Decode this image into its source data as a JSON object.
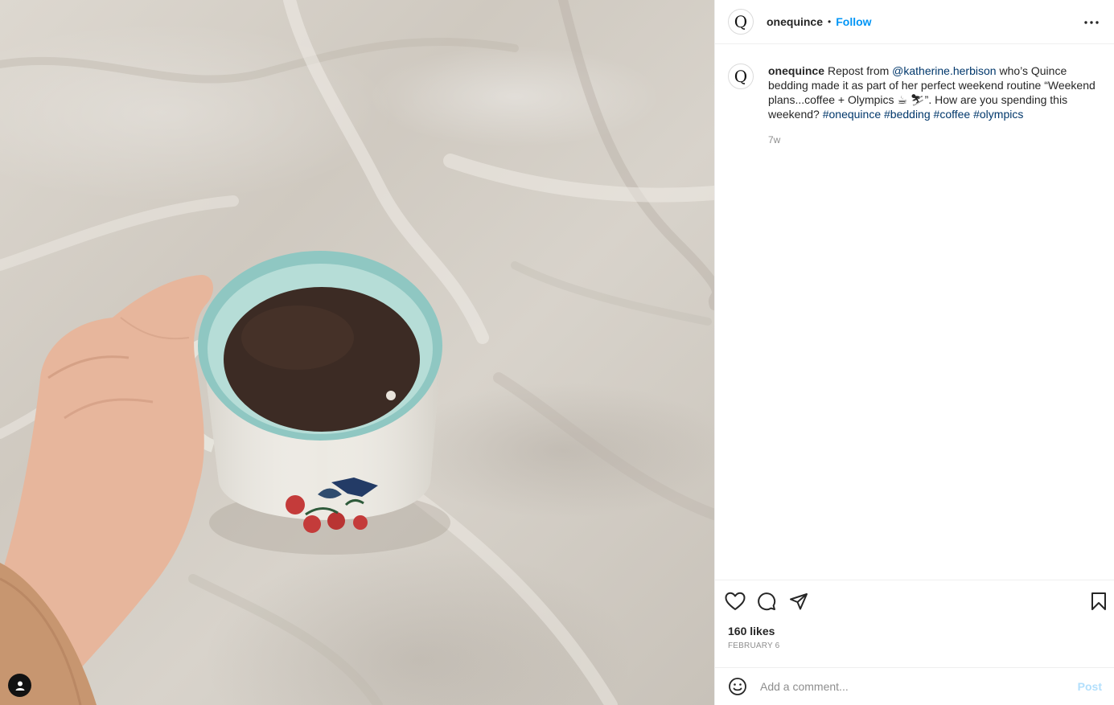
{
  "post": {
    "account": {
      "username": "onequince",
      "avatar_letter": "Q",
      "follow_label": "Follow",
      "separator": "•"
    },
    "caption": {
      "username": "onequince",
      "text_1": "Repost from ",
      "mention": "@katherine.herbison",
      "text_2": " who’s Quince bedding made it as part of her perfect weekend routine “Weekend plans...coffee + Olympics ",
      "emojis": "☕ ⛷",
      "text_3": "”. How are you spending this weekend? ",
      "hashtags": [
        "#onequince",
        "#bedding",
        "#coffee",
        "#olympics"
      ],
      "time_ago": "7w"
    },
    "likes": "160 likes",
    "date": "FEBRUARY 6",
    "comment": {
      "placeholder": "Add a comment...",
      "post_label": "Post"
    }
  },
  "colors": {
    "follow_blue": "#0095f6",
    "hashtag_navy": "#00376b",
    "post_disabled": "#b2dffc",
    "muted_text": "#8e8e8e"
  },
  "icons": [
    "more-options-icon",
    "heart-icon",
    "comment-icon",
    "share-icon",
    "bookmark-icon",
    "emoji-icon",
    "user-tag-icon"
  ]
}
